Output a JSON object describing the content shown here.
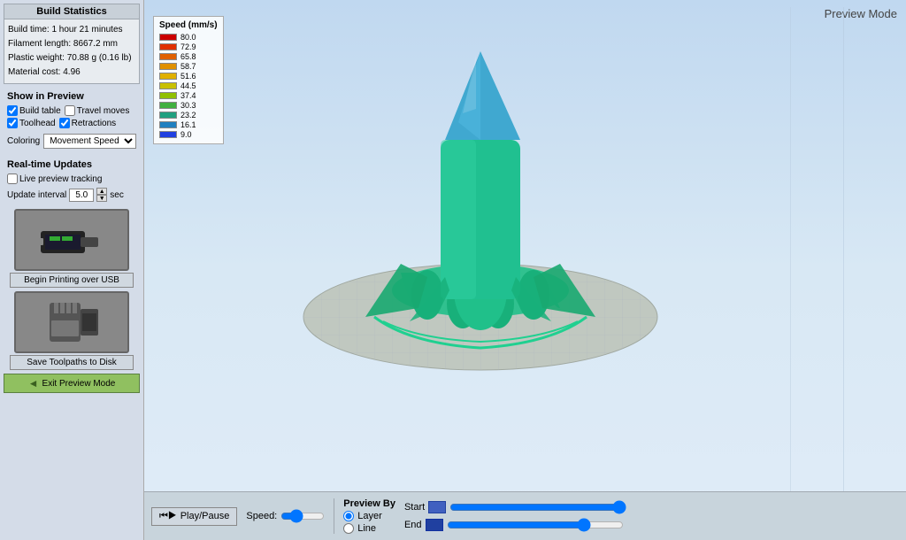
{
  "left_panel": {
    "build_stats": {
      "title": "Build Statistics",
      "build_time": "Build time: 1 hour 21 minutes",
      "filament_length": "Filament length: 8667.2 mm",
      "plastic_weight": "Plastic weight: 70.88 g (0.16 lb)",
      "material_cost": "Material cost: 4.96"
    },
    "show_preview": {
      "title": "Show in Preview",
      "checkboxes": [
        {
          "label": "Build table",
          "checked": true
        },
        {
          "label": "Travel moves",
          "checked": false
        },
        {
          "label": "Toolhead",
          "checked": true
        },
        {
          "label": "Retractions",
          "checked": true
        }
      ],
      "coloring_label": "Coloring",
      "coloring_value": "Movement Speed"
    },
    "realtime": {
      "title": "Real-time Updates",
      "live_preview_label": "Live preview tracking",
      "live_preview_checked": false,
      "update_interval_label": "Update interval",
      "update_interval_value": "5.0",
      "update_interval_unit": "sec"
    },
    "usb_button": {
      "label": "Begin Printing over USB"
    },
    "disk_button": {
      "label": "Save Toolpaths to Disk"
    },
    "exit_button": {
      "label": "Exit Preview Mode"
    }
  },
  "preview": {
    "mode_label": "Preview Mode",
    "speed_legend": {
      "title": "Speed (mm/s)",
      "items": [
        {
          "value": "80.0",
          "color": "#cc0000"
        },
        {
          "value": "72.9",
          "color": "#e03000"
        },
        {
          "value": "65.8",
          "color": "#e06000"
        },
        {
          "value": "58.7",
          "color": "#e09000"
        },
        {
          "value": "51.6",
          "color": "#e0b000"
        },
        {
          "value": "44.5",
          "color": "#c8c000"
        },
        {
          "value": "37.4",
          "color": "#90c000"
        },
        {
          "value": "30.3",
          "color": "#40b040"
        },
        {
          "value": "23.2",
          "color": "#20a080"
        },
        {
          "value": "16.1",
          "color": "#2080c0"
        },
        {
          "value": "9.0",
          "color": "#2040e0"
        }
      ]
    }
  },
  "bottom_bar": {
    "play_pause_label": "Play/Pause",
    "speed_label": "Speed:",
    "preview_by_label": "Preview By",
    "layer_label": "Layer",
    "line_label": "Line",
    "start_label": "Start",
    "end_label": "End"
  }
}
